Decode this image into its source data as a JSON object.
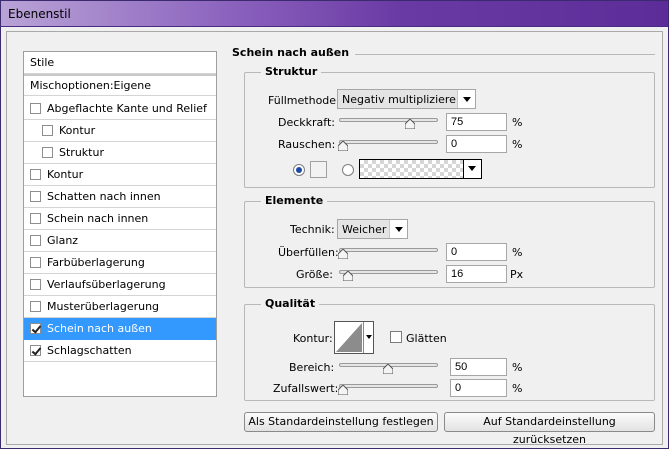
{
  "window": {
    "title": "Ebenenstil"
  },
  "styles_list": {
    "header": "Stile",
    "blend_options": "Mischoptionen:Eigene",
    "items": [
      {
        "label": "Abgeflachte Kante und Relief",
        "checked": false,
        "indent": false
      },
      {
        "label": "Kontur",
        "checked": false,
        "indent": true
      },
      {
        "label": "Struktur",
        "checked": false,
        "indent": true
      },
      {
        "label": "Kontur",
        "checked": false,
        "indent": false
      },
      {
        "label": "Schatten nach innen",
        "checked": false,
        "indent": false
      },
      {
        "label": "Schein nach innen",
        "checked": false,
        "indent": false
      },
      {
        "label": "Glanz",
        "checked": false,
        "indent": false
      },
      {
        "label": "Farbüberlagerung",
        "checked": false,
        "indent": false
      },
      {
        "label": "Verlaufsüberlagerung",
        "checked": false,
        "indent": false
      },
      {
        "label": "Musterüberlagerung",
        "checked": false,
        "indent": false
      },
      {
        "label": "Schein nach außen",
        "checked": true,
        "indent": false,
        "selected": true
      },
      {
        "label": "Schlagschatten",
        "checked": true,
        "indent": false
      }
    ]
  },
  "panel": {
    "title": "Schein nach außen",
    "structure": {
      "title": "Struktur",
      "blend_mode_label": "Füllmethode:",
      "blend_mode_value": "Negativ multiplizieren",
      "opacity_label": "Deckkraft:",
      "opacity_value": "75",
      "opacity_percent": 75,
      "noise_label": "Rauschen:",
      "noise_value": "0",
      "noise_percent": 0,
      "percent_unit": "%"
    },
    "elements": {
      "title": "Elemente",
      "technique_label": "Technik:",
      "technique_value": "Weicher",
      "spread_label": "Überfüllen:",
      "spread_value": "0",
      "spread_percent": 0,
      "size_label": "Größe:",
      "size_value": "16",
      "size_unit": "Px",
      "size_fraction": 0.06,
      "percent_unit": "%"
    },
    "quality": {
      "title": "Qualität",
      "contour_label": "Kontur:",
      "antialias_label": "Glätten",
      "range_label": "Bereich:",
      "range_value": "50",
      "range_percent": 50,
      "jitter_label": "Zufallswert:",
      "jitter_value": "0",
      "jitter_percent": 0,
      "percent_unit": "%"
    },
    "buttons": {
      "make_default": "Als Standardeinstellung festlegen",
      "reset_default": "Auf Standardeinstellung zurücksetzen"
    }
  },
  "colors": {
    "selection": "#3399ff",
    "title_gradient_end": "#5c2c98",
    "radio_dot": "#1b4aa8"
  }
}
